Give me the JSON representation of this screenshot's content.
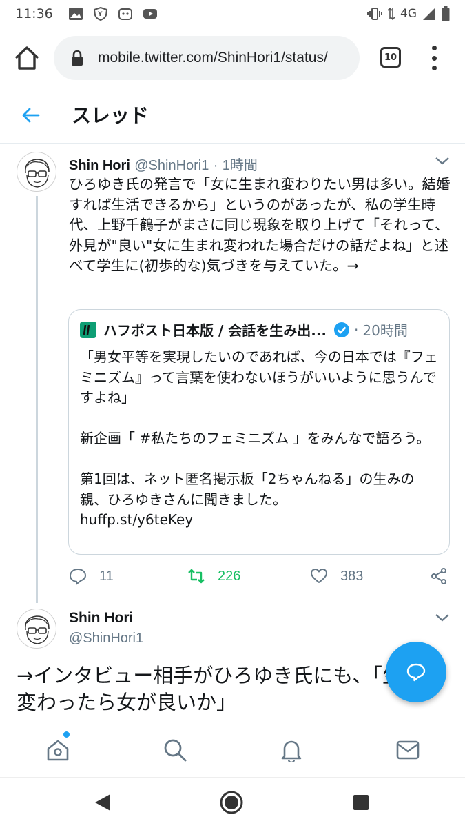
{
  "status_bar": {
    "time": "11:36",
    "network": "4G"
  },
  "browser": {
    "url": "mobile.twitter.com/ShinHori1/status/",
    "tab_count": "10"
  },
  "header": {
    "title": "スレッド"
  },
  "tweet1": {
    "name": "Shin Hori",
    "handle": "@ShinHori1",
    "dot": "·",
    "time": "1時間",
    "text": "ひろゆき氏の発言で「女に生まれ変わりたい男は多い。結婚すれば生活できるから」というのがあったが、私の学生時代、上野千鶴子がまさに同じ現象を取り上げて「それって、外見が\"良い\"女に生まれ変われた場合だけの話だよね」と述べて学生に(初歩的な)気づきを与えていた。→",
    "quote": {
      "name": "ハフポスト日本版 / 会話を生み出...",
      "dot": "·",
      "time": "20時間",
      "text": "「男女平等を実現したいのであれば、今の日本では『フェミニズム』って言葉を使わないほうがいいように思うんですよね」\n\n新企画「 #私たちのフェミニズム 」をみんなで語ろう。\n\n第1回は、ネット匿名掲示板「2ちゃんねる」の生みの親、ひろゆきさんに聞きました。\nhuffp.st/y6teKey"
    },
    "replies": "11",
    "retweets": "226",
    "likes": "383"
  },
  "tweet2": {
    "name": "Shin Hori",
    "handle": "@ShinHori1",
    "text": "→インタビュー相手がひろゆき氏にも、「生まれ変わったら女が良いか」"
  },
  "colors": {
    "accent": "#1da1f2",
    "retweet": "#17bf63",
    "muted": "#657786"
  }
}
